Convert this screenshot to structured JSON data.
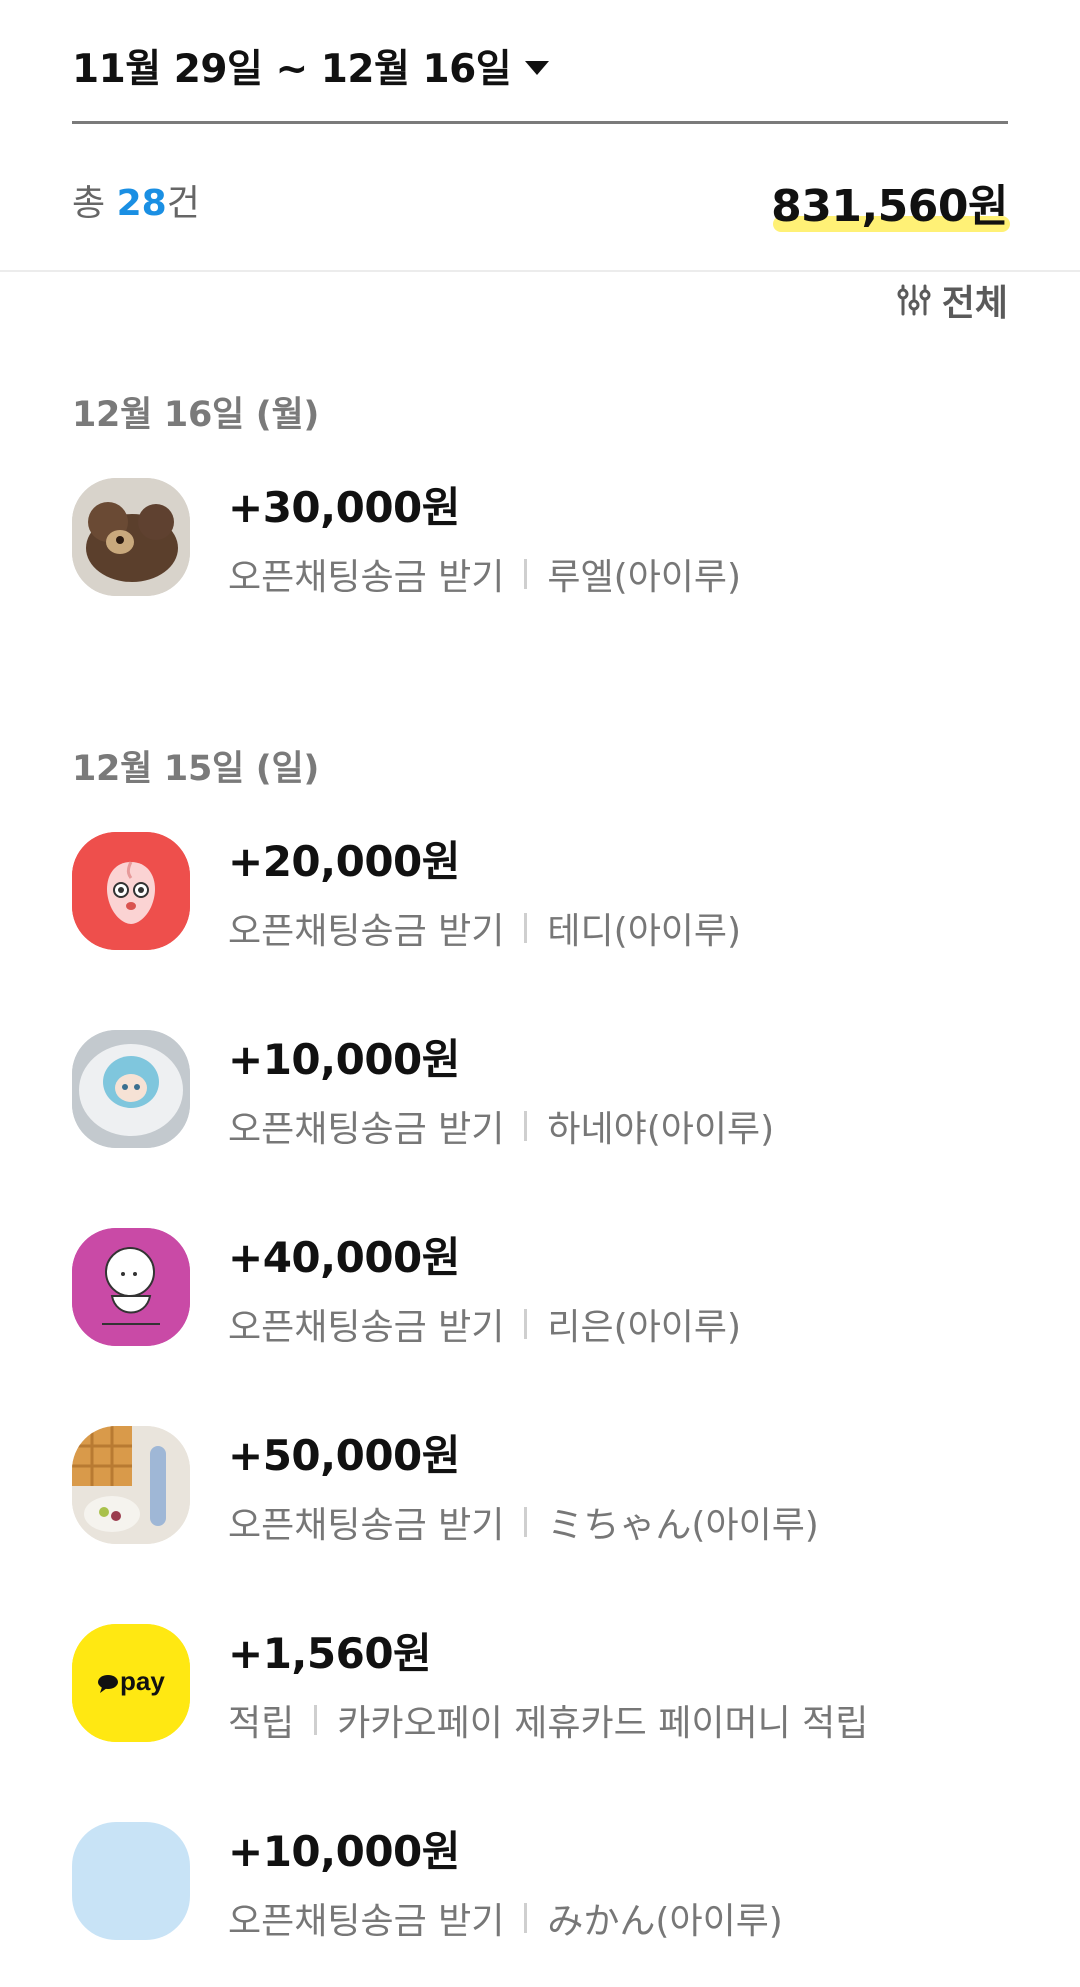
{
  "header": {
    "date_range": "11월 29일 ~ 12월 16일",
    "count_prefix": "총 ",
    "count_value": "28",
    "count_suffix": "건",
    "total": "831,560원",
    "filter_label": "전체"
  },
  "colors": {
    "accent_blue": "#1a8fe3",
    "highlight_yellow": "#fff176",
    "kakaopay_yellow": "#ffe812"
  },
  "sections": [
    {
      "date": "12월 16일 (월)",
      "items": [
        {
          "amount": "+30,000원",
          "type": "오픈채팅송금 받기",
          "name": "루엘(아이루)",
          "avatar": "bear-plush-photo"
        }
      ]
    },
    {
      "date": "12월 15일 (일)",
      "items": [
        {
          "amount": "+20,000원",
          "type": "오픈채팅송금 받기",
          "name": "테디(아이루)",
          "avatar": "apeach-character"
        },
        {
          "amount": "+10,000원",
          "type": "오픈채팅송금 받기",
          "name": "하네야(아이루)",
          "avatar": "anime-cake-photo"
        },
        {
          "amount": "+40,000원",
          "type": "오픈채팅송금 받기",
          "name": "리은(아이루)",
          "avatar": "sketch-character"
        },
        {
          "amount": "+50,000원",
          "type": "오픈채팅송금 받기",
          "name": "ミちゃん(아이루)",
          "avatar": "food-photo"
        },
        {
          "amount": "+1,560원",
          "type": "적립",
          "name": "카카오페이 제휴카드 페이머니 적립",
          "avatar": "kakaopay-logo",
          "logo_text": "pay"
        },
        {
          "amount": "+10,000원",
          "type": "오픈채팅송금 받기",
          "name": "みかん(아이루)",
          "avatar": "blank-profile"
        }
      ]
    }
  ]
}
